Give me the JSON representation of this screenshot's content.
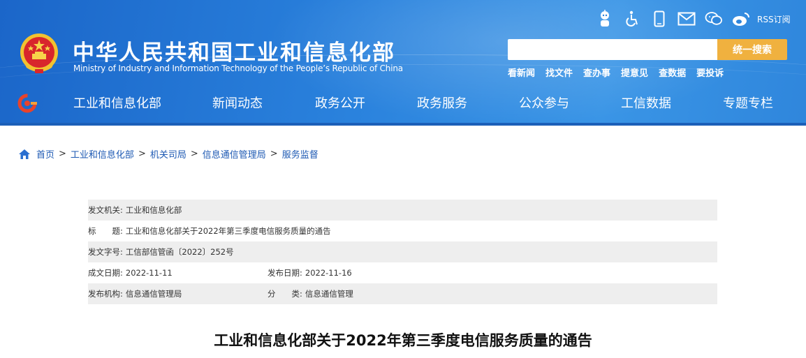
{
  "header": {
    "title": "中华人民共和国工业和信息化部",
    "subtitle": "Ministry of Industry and Information Technology of the People’s Republic of China",
    "toolbar": {
      "icons": [
        "robot-assistant-icon",
        "accessibility-icon",
        "mobile-icon",
        "mail-icon",
        "wechat-icon",
        "weibo-icon"
      ],
      "rss_label": "RSS订阅"
    },
    "search": {
      "placeholder": "",
      "button_label": "统一搜索"
    },
    "quick_links": [
      "看新闻",
      "找文件",
      "查办事",
      "提意见",
      "查数据",
      "要投诉"
    ],
    "colors": {
      "header_blue": "#2a82dd",
      "search_button": "#f0b13f",
      "link_blue": "#1d59b3"
    }
  },
  "nav": {
    "items": [
      "工业和信息化部",
      "新闻动态",
      "政务公开",
      "政务服务",
      "公众参与",
      "工信数据",
      "专题专栏"
    ]
  },
  "breadcrumb": {
    "home": "首页",
    "items": [
      "工业和信息化部",
      "机关司局",
      "信息通信管理局",
      "服务监督"
    ],
    "separator": ">"
  },
  "meta": {
    "issuer_label": "发文机关:",
    "issuer_value": "工业和信息化部",
    "title_label": "标　　题:",
    "title_value": "工业和信息化部关于2022年第三季度电信服务质量的通告",
    "doc_number_label": "发文字号:",
    "doc_number_value": "工信部信管函〔2022〕252号",
    "written_date_label": "成文日期:",
    "written_date_value": "2022-11-11",
    "publish_date_label": "发布日期:",
    "publish_date_value": "2022-11-16",
    "org_label": "发布机构:",
    "org_value": "信息通信管理局",
    "category_label": "分　　类:",
    "category_value": "信息通信管理"
  },
  "article": {
    "title": "工业和信息化部关于2022年第三季度电信服务质量的通告"
  }
}
